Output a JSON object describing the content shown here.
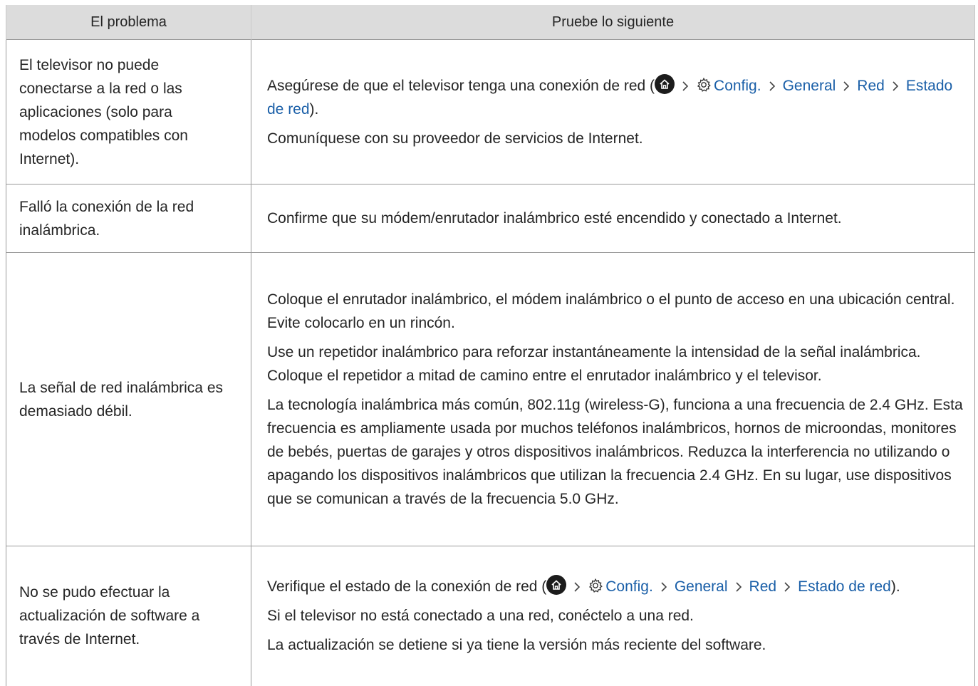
{
  "header": {
    "col1": "El problema",
    "col2": "Pruebe lo siguiente"
  },
  "rows": [
    {
      "problem": "El televisor no puede conectarse a la red o las aplicaciones (solo para modelos compatibles con Internet).",
      "p1": {
        "before": "Asegúrese de que el televisor tenga una conexión de red (",
        "config": "Config.",
        "general": "General",
        "red": "Red",
        "estado": "Estado de red",
        "after": ")."
      },
      "p2": "Comuníquese con su proveedor de servicios de Internet."
    },
    {
      "problem": "Falló la conexión de la red inalámbrica.",
      "p1": "Confirme que su módem/enrutador inalámbrico esté encendido y conectado a Internet."
    },
    {
      "problem": "La señal de red inalámbrica es demasiado débil.",
      "p1": "Coloque el enrutador inalámbrico, el módem inalámbrico o el punto de acceso en una ubicación central. Evite colocarlo en un rincón.",
      "p2": "Use un repetidor inalámbrico para reforzar instantáneamente la intensidad de la señal inalámbrica. Coloque el repetidor a mitad de camino entre el enrutador inalámbrico y el televisor.",
      "p3": "La tecnología inalámbrica más común, 802.11g (wireless-G), funciona a una frecuencia de 2.4 GHz. Esta frecuencia es ampliamente usada por muchos teléfonos inalámbricos, hornos de microondas, monitores de bebés, puertas de garajes y otros dispositivos inalámbricos. Reduzca la interferencia no utilizando o apagando los dispositivos inalámbricos que utilizan la frecuencia 2.4 GHz. En su lugar, use dispositivos que se comunican a través de la frecuencia 5.0 GHz."
    },
    {
      "problem": "No se pudo efectuar la actualización de software a través de Internet.",
      "p1": {
        "before": "Verifique el estado de la conexión de red (",
        "config": "Config.",
        "general": "General",
        "red": "Red",
        "estado": "Estado de red",
        "after": ")."
      },
      "p2": "Si el televisor no está conectado a una red, conéctelo a una red.",
      "p3": "La actualización se detiene si ya tiene la versión más reciente del software."
    }
  ],
  "icons": {
    "home": "home-icon",
    "settings": "gear-icon",
    "separator": "chevron-right-icon"
  },
  "colors": {
    "link": "#1a5fa8",
    "header_bg": "#dcdcdc"
  }
}
